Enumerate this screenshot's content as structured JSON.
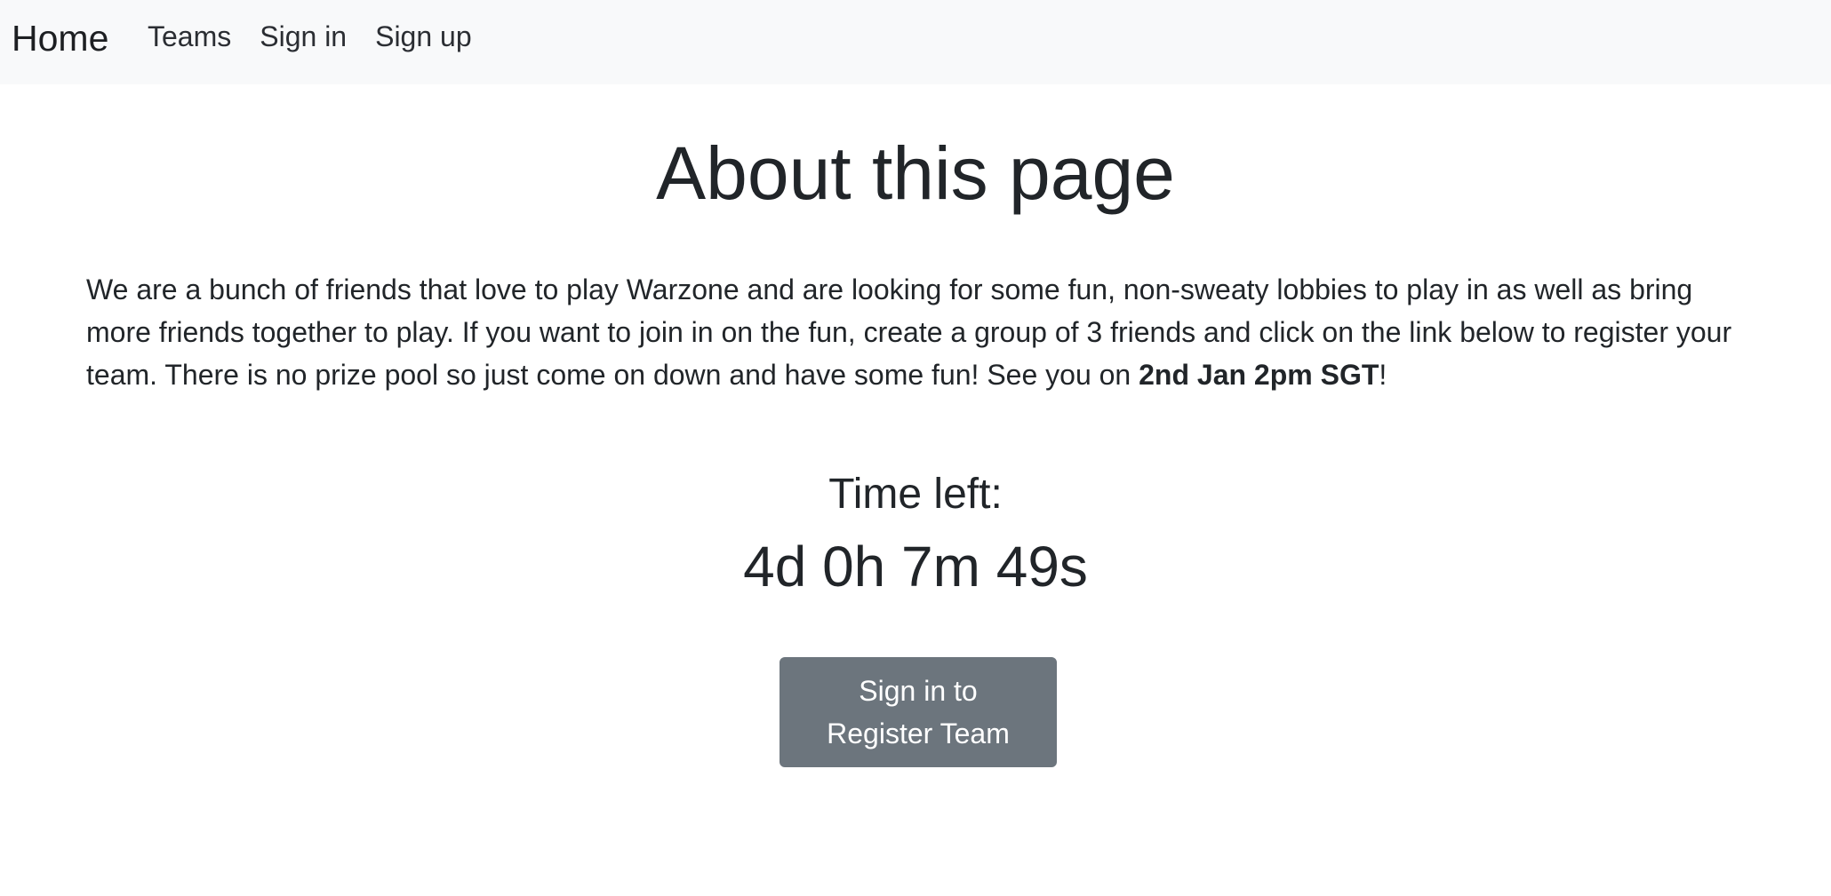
{
  "navbar": {
    "brand": "Home",
    "links": [
      "Teams",
      "Sign in",
      "Sign up"
    ]
  },
  "main": {
    "title": "About this page",
    "about_text_part1": "We are a bunch of friends that love to play Warzone and are looking for some fun, non-sweaty lobbies to play in as well as bring more friends together to play. If you want to join in on the fun, create a group of 3 friends and click on the link below to register your team. There is no prize pool so just come on down and have some fun! See you on ",
    "about_text_bold": "2nd Jan 2pm SGT",
    "about_text_part2": "!",
    "time_left_label": "Time left:",
    "countdown": "4d 0h 7m 49s",
    "register_button_line1": "Sign in to",
    "register_button_line2": "Register Team"
  },
  "colors": {
    "navbar_bg": "#f8f9fa",
    "text": "#212529",
    "button_bg": "#6c757d",
    "button_text": "#ffffff"
  }
}
